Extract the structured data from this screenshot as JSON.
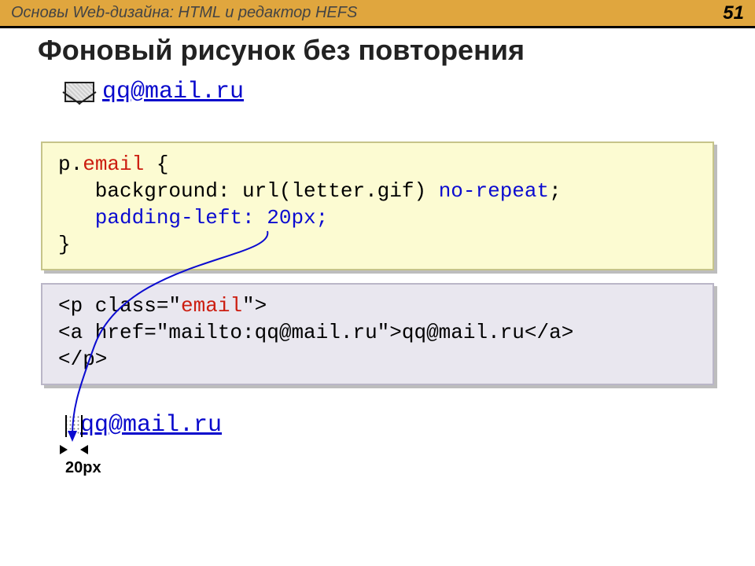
{
  "header": {
    "title": "Основы Web-дизайна: HTML и редактор HEFS",
    "page": "51"
  },
  "title": "Фоновый рисунок без повторения",
  "example_email": "qq@mail.ru",
  "css_code": {
    "line1_a": "p.",
    "line1_b": "email",
    "line1_c": " {",
    "line2_a": "   background: url(letter.gif) ",
    "line2_b": "no-repeat",
    "line2_c": ";",
    "line3_a": "   padding-left: 20px;",
    "line4": "}"
  },
  "html_code": {
    "line1_a": "<p class=\"",
    "line1_b": "email",
    "line1_c": "\">",
    "line2": "<a href=\"mailto:qq@mail.ru\">qq@mail.ru</a>",
    "line3": "</p>"
  },
  "measure_label": "20px"
}
